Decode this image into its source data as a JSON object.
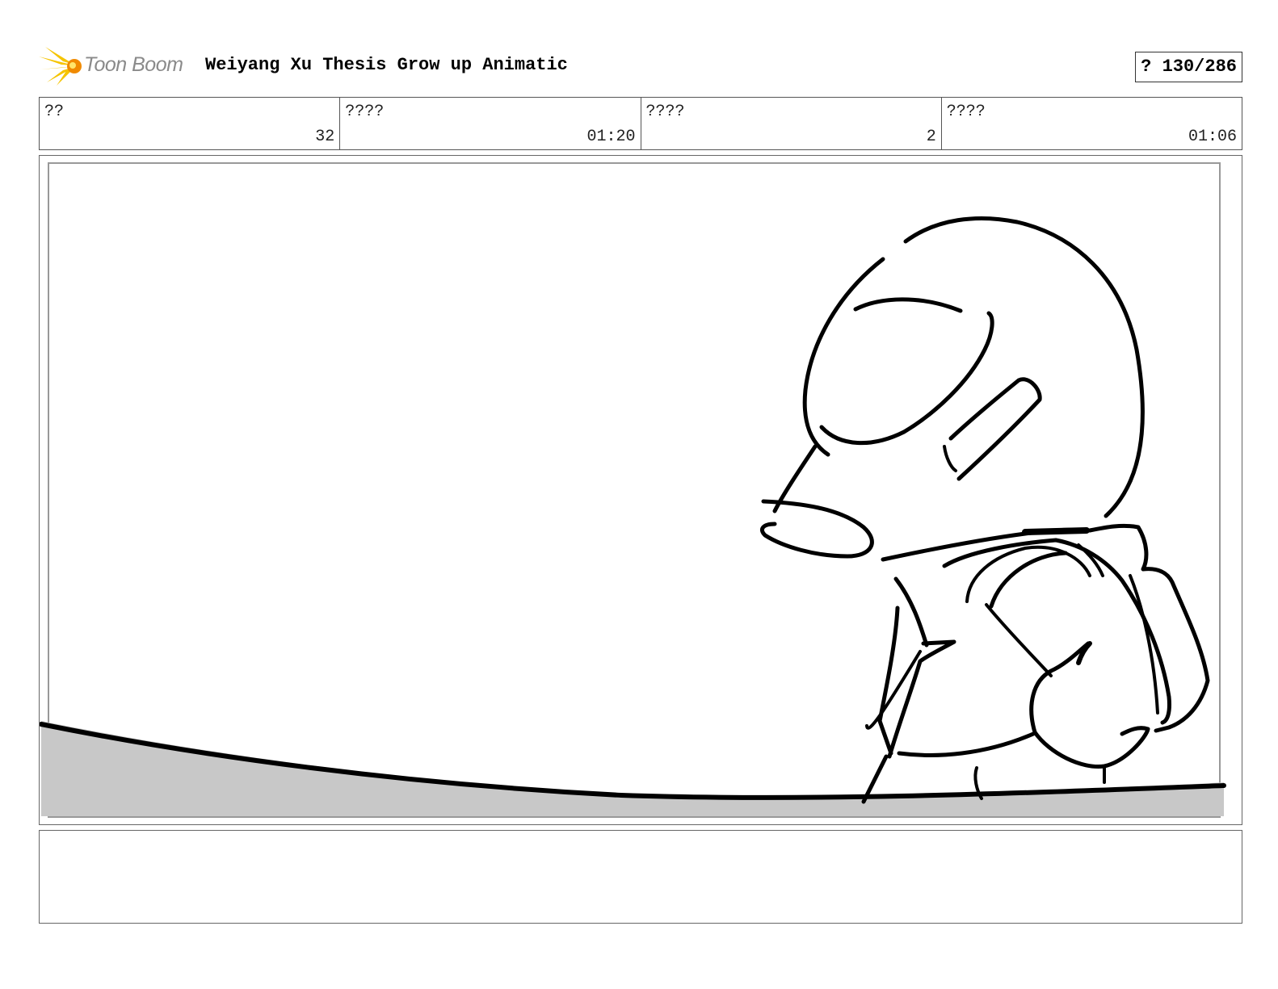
{
  "header": {
    "logo_text": "Toon Boom",
    "title": "Weiyang Xu Thesis Grow up Animatic",
    "page_indicator": "? 130/286"
  },
  "info": [
    {
      "label": "??",
      "value": "32"
    },
    {
      "label": "????",
      "value": "01:20"
    },
    {
      "label": "????",
      "value": "2"
    },
    {
      "label": "????",
      "value": "01:06"
    }
  ],
  "notes": {
    "text": ""
  },
  "colors": {
    "ground_fill": "#c8c8c8",
    "logo_flame": "#f5c400",
    "logo_text": "#8a8a8a"
  }
}
